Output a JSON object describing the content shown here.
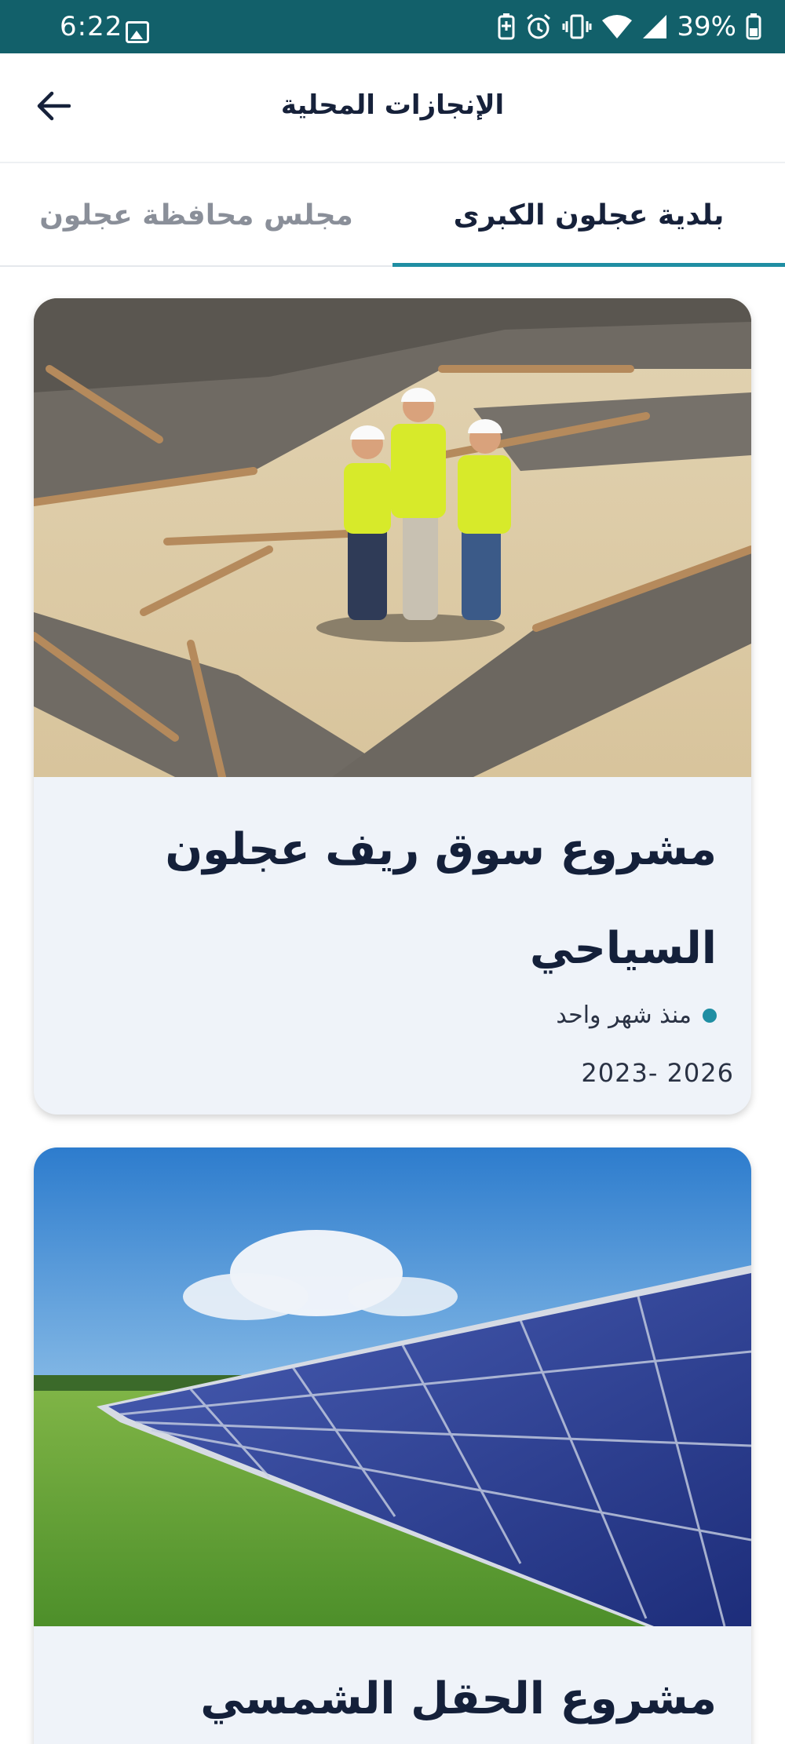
{
  "status_bar": {
    "time": "6:22",
    "battery_text": "39%"
  },
  "app_bar": {
    "title": "الإنجازات المحلية",
    "back_icon": "arrow-left-icon"
  },
  "tabs": [
    {
      "label": "بلدية عجلون الكبرى",
      "selected": true
    },
    {
      "label": "مجلس محافظة عجلون",
      "selected": false
    }
  ],
  "colors": {
    "status_bar": "#12606a",
    "accent": "#1f8ea3",
    "card_bg": "#eff3f9"
  },
  "cards": [
    {
      "title": "مشروع سوق ريف عجلون السياحي",
      "time_ago": "منذ شهر واحد",
      "date_range": "2023- 2026",
      "image": "construction-site-photo"
    },
    {
      "title": "مشروع الحقل الشمسي",
      "image": "solar-field-photo"
    }
  ]
}
